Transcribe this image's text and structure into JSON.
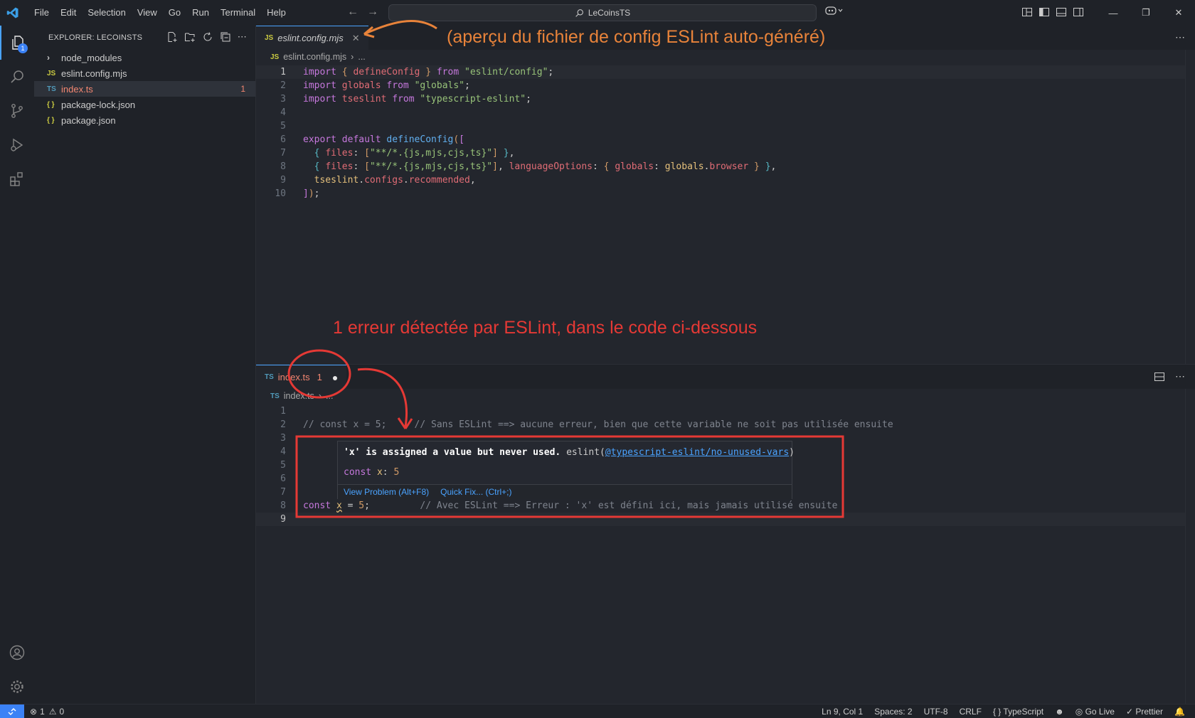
{
  "menu": [
    "File",
    "Edit",
    "Selection",
    "View",
    "Go",
    "Run",
    "Terminal",
    "Help"
  ],
  "search": {
    "text": "LeCoinsTS"
  },
  "activity": {
    "explorer_badge": "1"
  },
  "explorer": {
    "title": "EXPLORER: LECOINSTS",
    "items": [
      {
        "label": "node_modules",
        "icon": "chevron-right"
      },
      {
        "label": "eslint.config.mjs",
        "icon": "JS"
      },
      {
        "label": "index.ts",
        "icon": "TS",
        "count": "1"
      },
      {
        "label": "package-lock.json",
        "icon": "{ }"
      },
      {
        "label": "package.json",
        "icon": "{ }"
      }
    ]
  },
  "editor_top": {
    "tab_lang": "JS",
    "tab_label": "eslint.config.mjs",
    "breadcrumb_lang": "JS",
    "breadcrumb": "eslint.config.mjs",
    "breadcrumb_more": "...",
    "line_numbers": [
      "1",
      "2",
      "3",
      "4",
      "5",
      "6",
      "7",
      "8",
      "9",
      "10"
    ],
    "code": {
      "l1_import": "import",
      "l1_name": "defineConfig",
      "l1_from": "from",
      "l1_src": "\"eslint/config\"",
      "l2_import": "import",
      "l2_name": "globals",
      "l2_from": "from",
      "l2_src": "\"globals\"",
      "l3_import": "import",
      "l3_name": "tseslint",
      "l3_from": "from",
      "l3_src": "\"typescript-eslint\"",
      "l6_export": "export",
      "l6_default": "default",
      "l6_fn": "defineConfig",
      "l7_files": "files",
      "l7_pattern": "\"**/*.{js,mjs,cjs,ts}\"",
      "l8_files": "files",
      "l8_pattern": "\"**/*.{js,mjs,cjs,ts}\"",
      "l8_langopts": "languageOptions",
      "l8_globals_key": "globals",
      "l8_globals_obj": "globals",
      "l8_browser": "browser",
      "l9_tseslint": "tseslint",
      "l9_configs": "configs",
      "l9_recommended": "recommended"
    }
  },
  "editor_bottom": {
    "tab_lang": "TS",
    "tab_label": "index.ts",
    "tab_count": "1",
    "breadcrumb_lang": "TS",
    "breadcrumb": "index.ts",
    "breadcrumb_more": "...",
    "line_numbers": [
      "1",
      "2",
      "3",
      "4",
      "5",
      "6",
      "7",
      "8",
      "9"
    ],
    "code": {
      "l2_comment1": "// const x = 5;",
      "l2_comment2": "// Sans ESLint ==> aucune erreur, bien que cette variable ne soit pas utilisée ensuite",
      "l8_const": "const",
      "l8_var": "x",
      "l8_eq": "=",
      "l8_val": "5",
      "l8_comment": "// Avec ESLint ==> Erreur : 'x' est défini ici, mais jamais utilisé ensuite"
    }
  },
  "hover": {
    "message": "'x' is assigned a value but never used.",
    "source": "eslint(",
    "rule": "@typescript-eslint/no-unused-vars",
    "source_close": ")",
    "decl_const": "const",
    "decl_name": "x",
    "decl_value": "5",
    "view_problem": "View Problem (Alt+F8)",
    "quick_fix": "Quick Fix... (Ctrl+;)"
  },
  "annotations": {
    "top": "(aperçu du fichier de config ESLint auto-généré)",
    "middle": "1 erreur détectée par ESLint, dans le code ci-dessous"
  },
  "status": {
    "errors": "1",
    "warnings": "0",
    "position": "Ln 9, Col 1",
    "spaces": "Spaces: 2",
    "encoding": "UTF-8",
    "eol": "CRLF",
    "language": "TypeScript",
    "golive": "Go Live",
    "prettier": "Prettier"
  },
  "colors": {
    "annotation_orange": "#e8833a",
    "annotation_red": "#e53935",
    "accent": "#3b82f6"
  }
}
